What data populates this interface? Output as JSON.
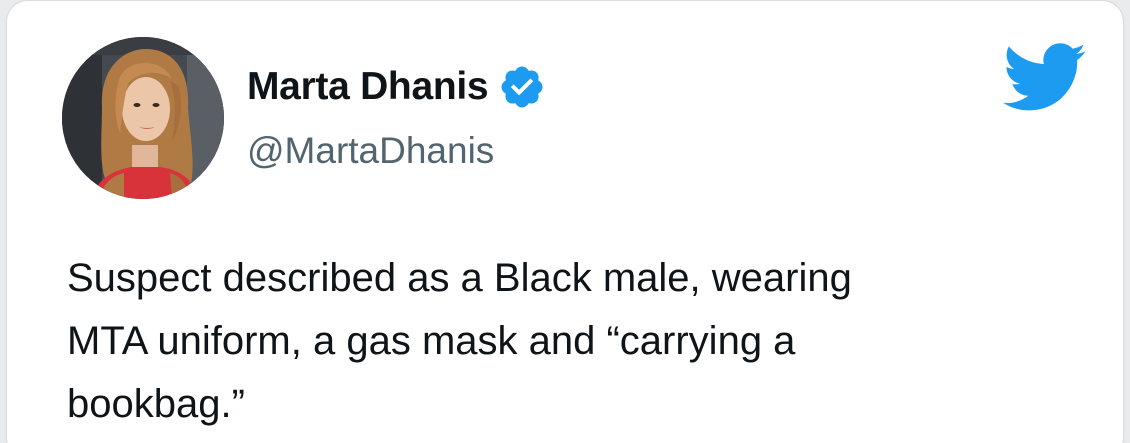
{
  "tweet": {
    "author": {
      "display_name": "Marta Dhanis",
      "handle": "@MartaDhanis",
      "verified_icon": "verified-badge-icon",
      "avatar": "profile-photo"
    },
    "platform_icon": "twitter-bird-icon",
    "text_lines": [
      "Suspect described as a Black male, wearing",
      "MTA uniform, a gas mask and “carrying a",
      "bookbag.”"
    ]
  },
  "colors": {
    "twitter_blue": "#1d9bf0",
    "text_primary": "#0f1419",
    "text_secondary": "#536471",
    "card_background": "#ffffff"
  }
}
